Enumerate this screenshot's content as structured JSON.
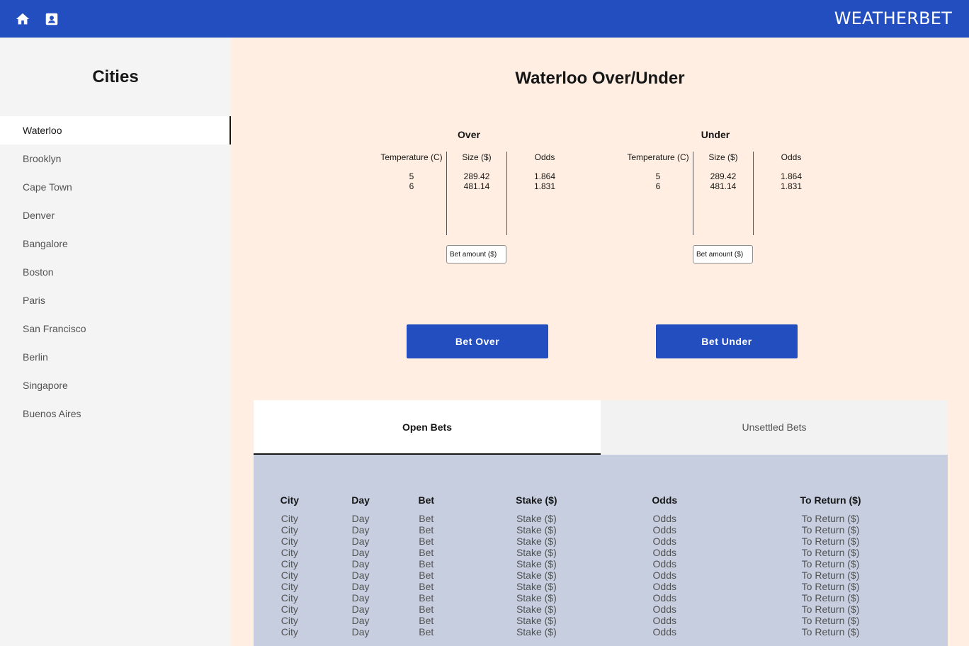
{
  "topbar": {
    "brand": "WEATHERBET",
    "icons": [
      "home-icon",
      "contact-card-icon"
    ],
    "color": "#224ec0"
  },
  "sidebar": {
    "title": "Cities",
    "items": [
      {
        "label": "Waterloo",
        "active": true
      },
      {
        "label": "Brooklyn"
      },
      {
        "label": "Cape Town"
      },
      {
        "label": "Denver"
      },
      {
        "label": "Bangalore"
      },
      {
        "label": "Boston"
      },
      {
        "label": "Paris"
      },
      {
        "label": "San Francisco"
      },
      {
        "label": "Berlin"
      },
      {
        "label": "Singapore"
      },
      {
        "label": "Buenos Aires"
      }
    ]
  },
  "main": {
    "title_city": "Waterloo",
    "title_suffix": " Over/Under"
  },
  "over": {
    "title": "Over",
    "headers": {
      "temp": "Temperature (C)",
      "size": "Size ($)",
      "odds": "Odds"
    },
    "rows": [
      {
        "temp": "5",
        "size": "289.42",
        "odds": "1.864"
      },
      {
        "temp": "6",
        "size": "481.14",
        "odds": "1.831"
      }
    ],
    "input_placeholder": "Bet amount ($)",
    "button": "Bet Over"
  },
  "under": {
    "title": "Under",
    "headers": {
      "temp": "Temperature (C)",
      "size": "Size ($)",
      "odds": "Odds"
    },
    "rows": [
      {
        "temp": "5",
        "size": "289.42",
        "odds": "1.864"
      },
      {
        "temp": "6",
        "size": "481.14",
        "odds": "1.831"
      }
    ],
    "input_placeholder": "Bet amount ($)",
    "button": "Bet Under"
  },
  "tabs": [
    {
      "label": "Open Bets",
      "active": true
    },
    {
      "label": "Unsettled Bets"
    }
  ],
  "bets_table": {
    "headers": [
      "City",
      "Day",
      "Bet",
      "Stake ($)",
      "Odds",
      "To Return ($)"
    ],
    "rows": [
      [
        "City",
        "Day",
        "Bet",
        "Stake ($)",
        "Odds",
        "To Return ($)"
      ],
      [
        "City",
        "Day",
        "Bet",
        "Stake ($)",
        "Odds",
        "To Return ($)"
      ],
      [
        "City",
        "Day",
        "Bet",
        "Stake ($)",
        "Odds",
        "To Return ($)"
      ],
      [
        "City",
        "Day",
        "Bet",
        "Stake ($)",
        "Odds",
        "To Return ($)"
      ],
      [
        "City",
        "Day",
        "Bet",
        "Stake ($)",
        "Odds",
        "To Return ($)"
      ],
      [
        "City",
        "Day",
        "Bet",
        "Stake ($)",
        "Odds",
        "To Return ($)"
      ],
      [
        "City",
        "Day",
        "Bet",
        "Stake ($)",
        "Odds",
        "To Return ($)"
      ],
      [
        "City",
        "Day",
        "Bet",
        "Stake ($)",
        "Odds",
        "To Return ($)"
      ],
      [
        "City",
        "Day",
        "Bet",
        "Stake ($)",
        "Odds",
        "To Return ($)"
      ],
      [
        "City",
        "Day",
        "Bet",
        "Stake ($)",
        "Odds",
        "To Return ($)"
      ],
      [
        "City",
        "Day",
        "Bet",
        "Stake ($)",
        "Odds",
        "To Return ($)"
      ]
    ]
  }
}
